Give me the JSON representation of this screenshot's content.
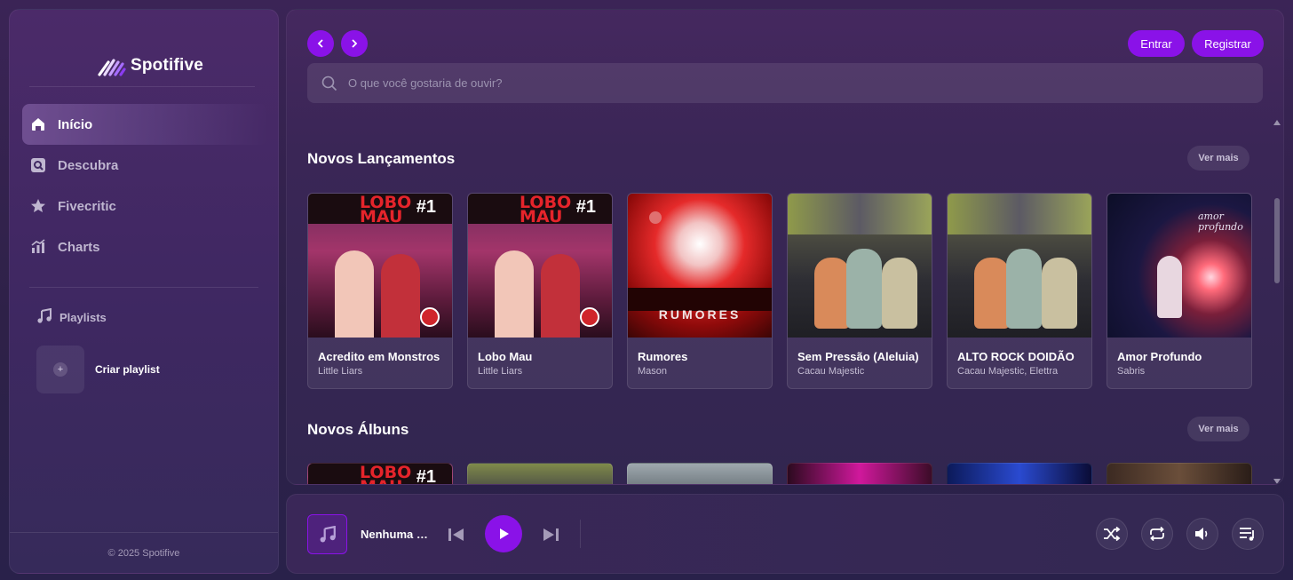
{
  "app": {
    "name": "Spotifive"
  },
  "sidebar": {
    "items": [
      {
        "label": "Início",
        "icon": "home-icon",
        "active": true
      },
      {
        "label": "Descubra",
        "icon": "discover-icon",
        "active": false
      },
      {
        "label": "Fivecritic",
        "icon": "star-icon",
        "active": false
      },
      {
        "label": "Charts",
        "icon": "chart-icon",
        "active": false
      }
    ],
    "playlists_label": "Playlists",
    "create_playlist_label": "Criar playlist",
    "copyright": "© 2025 Spotifive"
  },
  "header": {
    "login_label": "Entrar",
    "register_label": "Registrar",
    "search_placeholder": "O que você gostaria de ouvir?"
  },
  "sections": [
    {
      "title": "Novos Lançamentos",
      "see_more": "Ver mais",
      "cards": [
        {
          "title": "Acredito em Monstros",
          "subtitle": "Little Liars",
          "cover": "lobo"
        },
        {
          "title": "Lobo Mau",
          "subtitle": "Little Liars",
          "cover": "lobo"
        },
        {
          "title": "Rumores",
          "subtitle": "Mason",
          "cover": "rumores"
        },
        {
          "title": "Sem Pressão (Aleluia)",
          "subtitle": "Cacau Majestic",
          "cover": "sem"
        },
        {
          "title": "ALTO ROCK DOIDÃO",
          "subtitle": "Cacau Majestic, Elettra",
          "cover": "sem"
        },
        {
          "title": "Amor Profundo",
          "subtitle": "Sabris",
          "cover": "amor"
        }
      ]
    },
    {
      "title": "Novos Álbuns",
      "see_more": "Ver mais"
    }
  ],
  "covers": {
    "lobo_title": "LOBO MAU",
    "lobo_number": "#1",
    "rumores_text": "RUMORES",
    "amor_script": "amor profundo"
  },
  "player": {
    "now_playing": "Nenhuma música",
    "accent": "#8a12e8"
  }
}
